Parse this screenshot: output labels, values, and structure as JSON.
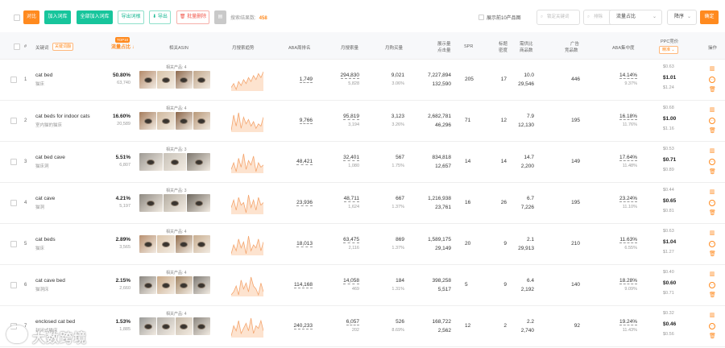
{
  "toolbar": {
    "compare_label": "对比",
    "add_lib_label": "加入词库",
    "add_all_lib_label": "全部加入词库",
    "export_roots_label": "导出词根",
    "export_label": "导出",
    "batch_delete_label": "批量删除",
    "result_label": "搜索结果数:",
    "result_count": "458",
    "show_top10_label": "展示前10产品图",
    "locate_placeholder": "锁定关键词",
    "exclude_placeholder": "排除",
    "sort_field": "流量占比",
    "sort_order": "降序",
    "confirm_label": "确定"
  },
  "headers": {
    "index": "#",
    "keyword": "关键词",
    "keyword_badge": "关键词翻",
    "flow": "流量占比",
    "flow_tag": "TOP10",
    "asin": "相关ASIN",
    "trend": "月搜索趋势",
    "aba": "ABA周排名",
    "monthly_search": "月搜索量",
    "monthly_buy": "月购买量",
    "impressions_line1": "展示量",
    "impressions_line2": "点击量",
    "spr": "SPR",
    "title_density_line1": "标题",
    "title_density_line2": "密度",
    "supply_line1": "需供比",
    "supply_line2": "商品数",
    "ads_line1": "广告",
    "ads_line2": "竞品数",
    "aba_concentration": "ABA集中度",
    "ppc": "PPC竞价",
    "ppc_tag": "精准",
    "operations": "操作"
  },
  "rows": [
    {
      "idx": "1",
      "kw": "cat bed",
      "kwcn": "猫床",
      "flow": "50.80%",
      "flow_sub": "63,740",
      "asin_label": "相关产品: 4",
      "aba": "1,749",
      "ms": "294,830",
      "ms_sub": "5,828",
      "mb": "9,021",
      "mb_sub": "3.06%",
      "imp": "7,227,894",
      "clk": "132,590",
      "spr": "205",
      "title": "17",
      "supply": "10.0",
      "supply_sub": "29,546",
      "ads": "446",
      "aba_c": "14.14%",
      "aba_c_sub": "9.37%",
      "ppc_top": "$0.63",
      "ppc": "$1.01",
      "ppc_bot": "$1.24",
      "spark": [
        6,
        10,
        4,
        12,
        8,
        14,
        10,
        16,
        12,
        18,
        14,
        20,
        16,
        22
      ]
    },
    {
      "idx": "2",
      "kw": "cat beds for indoor cats",
      "kwcn": "室内猫的猫床",
      "flow": "16.60%",
      "flow_sub": "20,589",
      "asin_label": "相关产品: 4",
      "aba": "9,766",
      "ms": "95,819",
      "ms_sub": "3,194",
      "mb": "3,123",
      "mb_sub": "3.26%",
      "imp": "2,682,781",
      "clk": "46,296",
      "spr": "71",
      "title": "12",
      "supply": "7.9",
      "supply_sub": "12,130",
      "ads": "195",
      "aba_c": "16.18%",
      "aba_c_sub": "11.76%",
      "ppc_top": "$0.68",
      "ppc": "$1.00",
      "ppc_bot": "$1.16",
      "spark": [
        4,
        18,
        8,
        20,
        6,
        16,
        10,
        14,
        8,
        12,
        6,
        10,
        8,
        16
      ]
    },
    {
      "idx": "3",
      "kw": "cat bed cave",
      "kwcn": "猫床洞",
      "flow": "5.51%",
      "flow_sub": "6,807",
      "asin_label": "相关产品: 3",
      "aba": "48,421",
      "ms": "32,401",
      "ms_sub": "1,080",
      "mb": "567",
      "mb_sub": "1.75%",
      "imp": "834,818",
      "clk": "12,657",
      "spr": "14",
      "title": "14",
      "supply": "14.7",
      "supply_sub": "2,200",
      "ads": "149",
      "aba_c": "17.64%",
      "aba_c_sub": "11.48%",
      "ppc_top": "$0.53",
      "ppc": "$0.71",
      "ppc_bot": "$0.89",
      "spark": [
        8,
        14,
        6,
        18,
        10,
        22,
        8,
        16,
        12,
        20,
        6,
        14,
        10,
        12
      ]
    },
    {
      "idx": "4",
      "kw": "cat cave",
      "kwcn": "猫洞",
      "flow": "4.21%",
      "flow_sub": "5,197",
      "asin_label": "相关产品: 3",
      "aba": "23,936",
      "ms": "48,711",
      "ms_sub": "1,624",
      "mb": "667",
      "mb_sub": "1.37%",
      "imp": "1,216,938",
      "clk": "23,761",
      "spr": "16",
      "title": "26",
      "supply": "6.7",
      "supply_sub": "7,226",
      "ads": "195",
      "aba_c": "23.24%",
      "aba_c_sub": "11.10%",
      "ppc_top": "$0.44",
      "ppc": "$0.65",
      "ppc_bot": "$0.81",
      "spark": [
        10,
        16,
        8,
        18,
        12,
        14,
        6,
        20,
        10,
        16,
        8,
        18,
        12,
        14
      ]
    },
    {
      "idx": "5",
      "kw": "cat beds",
      "kwcn": "猫床",
      "flow": "2.89%",
      "flow_sub": "3,565",
      "asin_label": "相关产品: 4",
      "aba": "18,013",
      "ms": "63,475",
      "ms_sub": "2,116",
      "mb": "869",
      "mb_sub": "1.37%",
      "imp": "1,589,175",
      "clk": "29,149",
      "spr": "20",
      "title": "9",
      "supply": "2.1",
      "supply_sub": "29,913",
      "ads": "210",
      "aba_c": "11.63%",
      "aba_c_sub": "6.55%",
      "ppc_top": "$0.63",
      "ppc": "$1.04",
      "ppc_bot": "$1.27",
      "spark": [
        6,
        12,
        8,
        16,
        10,
        14,
        6,
        18,
        8,
        12,
        10,
        16,
        8,
        14
      ]
    },
    {
      "idx": "6",
      "kw": "cat cave bed",
      "kwcn": "猫洞床",
      "flow": "2.15%",
      "flow_sub": "2,660",
      "asin_label": "相关产品: 4",
      "aba": "114,168",
      "ms": "14,058",
      "ms_sub": "469",
      "mb": "184",
      "mb_sub": "1.31%",
      "imp": "398,258",
      "clk": "5,517",
      "spr": "5",
      "title": "9",
      "supply": "6.4",
      "supply_sub": "2,192",
      "ads": "140",
      "aba_c": "18.28%",
      "aba_c_sub": "9.09%",
      "ppc_top": "$0.40",
      "ppc": "$0.60",
      "ppc_bot": "$0.71",
      "spark": [
        8,
        10,
        14,
        8,
        18,
        12,
        16,
        10,
        20,
        14,
        12,
        8,
        16,
        10
      ]
    },
    {
      "idx": "7",
      "kw": "enclosed cat bed",
      "kwcn": "封闭式猫床",
      "flow": "1.53%",
      "flow_sub": "1,885",
      "asin_label": "相关产品: 4",
      "aba": "240,233",
      "ms": "6,057",
      "ms_sub": "202",
      "mb": "526",
      "mb_sub": "8.69%",
      "imp": "168,722",
      "clk": "2,562",
      "spr": "12",
      "title": "2",
      "supply": "2.2",
      "supply_sub": "2,740",
      "ads": "92",
      "aba_c": "19.24%",
      "aba_c_sub": "11.43%",
      "ppc_top": "$0.32",
      "ppc": "$0.46",
      "ppc_bot": "$0.56",
      "spark": [
        6,
        14,
        10,
        18,
        8,
        12,
        16,
        10,
        20,
        8,
        14,
        12,
        18,
        10
      ]
    }
  ],
  "watermark": {
    "text": "大数跨境"
  }
}
